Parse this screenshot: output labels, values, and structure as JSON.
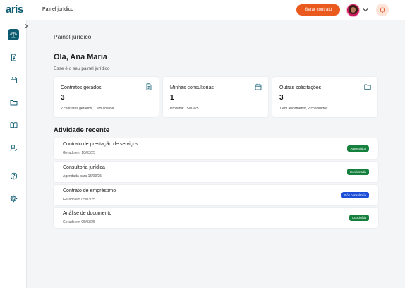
{
  "app": {
    "logo": "aris",
    "page_header": "Painel jurídico"
  },
  "topbar": {
    "generate_label": "Gerar contrato"
  },
  "colors": {
    "brand": "#0c5b70",
    "accent": "#ea5a1f",
    "success": "#15803d",
    "info": "#1d4ed8"
  },
  "sidebar": {
    "items": [
      {
        "icon": "scale-icon",
        "active": true
      },
      {
        "icon": "document-icon",
        "active": false
      },
      {
        "icon": "calendar-icon",
        "active": false
      },
      {
        "icon": "folder-icon",
        "active": false
      },
      {
        "icon": "book-icon",
        "active": false
      },
      {
        "icon": "user-check-icon",
        "active": false
      },
      {
        "icon": "help-icon",
        "active": false
      },
      {
        "icon": "gear-icon",
        "active": false
      }
    ]
  },
  "main": {
    "title": "Painel jurídico",
    "greeting": "Olá, Ana Maria",
    "subtitle": "Esse é o seu painel jurídico",
    "cards": [
      {
        "title": "Contratos gerados",
        "value": "3",
        "note": "2 contratos gerados, 1 em análise",
        "icon": "document-icon"
      },
      {
        "title": "Minhas consultorias",
        "value": "1",
        "note": "Próxima: 15/03/25",
        "icon": "calendar-icon"
      },
      {
        "title": "Outras solicitações",
        "value": "3",
        "note": "1 em andamento, 2 concluídos",
        "icon": "folder-icon"
      }
    ],
    "activity_title": "Atividade recente",
    "activities": [
      {
        "title": "Contrato de prestação de serviços",
        "date": "Gerado em 10/03/25",
        "status": "Automático",
        "status_color": "#15803d"
      },
      {
        "title": "Consultoria jurídica",
        "date": "Agendada para 15/03/25",
        "status": "Confirmada",
        "status_color": "#15803d"
      },
      {
        "title": "Contrato de empréstimo",
        "date": "Gerado em 05/03/25",
        "status": "Pós consultoria",
        "status_color": "#1d4ed8"
      },
      {
        "title": "Análise de documento",
        "date": "Gerado em 05/03/25",
        "status": "Concluída",
        "status_color": "#15803d"
      }
    ]
  }
}
